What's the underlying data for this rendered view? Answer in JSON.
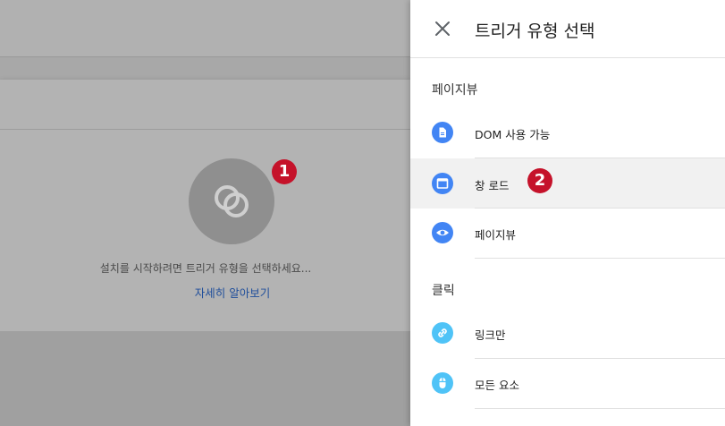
{
  "background": {
    "prompt_text": "설치를 시작하려면 트리거 유형을 선택하세요...",
    "learn_more_link": "자세히 알아보기",
    "callout_1": "1"
  },
  "panel": {
    "title": "트리거 유형 선택",
    "sections": [
      {
        "title": "페이지뷰",
        "items": [
          {
            "label": "DOM 사용 가능",
            "icon": "document-icon",
            "color": "#4285f4"
          },
          {
            "label": "창 로드",
            "icon": "window-icon",
            "color": "#4285f4",
            "highlighted": true,
            "callout": "2"
          },
          {
            "label": "페이지뷰",
            "icon": "eye-icon",
            "color": "#4285f4"
          }
        ]
      },
      {
        "title": "클릭",
        "items": [
          {
            "label": "링크만",
            "icon": "link-icon",
            "color": "#4fc3f7"
          },
          {
            "label": "모든 요소",
            "icon": "mouse-icon",
            "color": "#4fc3f7"
          }
        ]
      }
    ]
  },
  "colors": {
    "accent_blue": "#4285f4",
    "accent_light_blue": "#4fc3f7",
    "callout_red": "#c5122a",
    "link_blue": "#1f4e9b"
  }
}
